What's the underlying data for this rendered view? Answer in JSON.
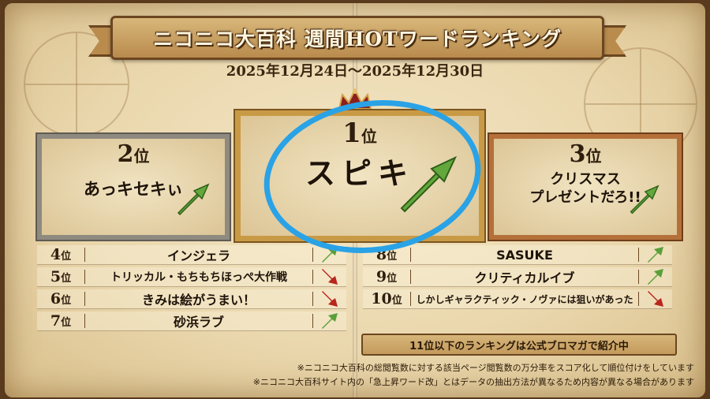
{
  "title": "ニコニコ大百科 週間HOTワードランキング",
  "date_range": "2025年12月24日〜2025年12月30日",
  "rank_suffix": "位",
  "top3": [
    {
      "rank": "1",
      "word": "スピキ",
      "trend": "up"
    },
    {
      "rank": "2",
      "word": "あっキセキぃ",
      "trend": "up"
    },
    {
      "rank": "3",
      "word": "クリスマス\nプレゼントだろ!!",
      "trend": "up"
    }
  ],
  "left_list": [
    {
      "rank": "4",
      "word": "インジェラ",
      "trend": "up"
    },
    {
      "rank": "5",
      "word": "トリッカル・もちもちほっぺ大作戦",
      "trend": "down"
    },
    {
      "rank": "6",
      "word": "きみは絵がうまい！",
      "trend": "down"
    },
    {
      "rank": "7",
      "word": "砂浜ラブ",
      "trend": "up"
    }
  ],
  "right_list": [
    {
      "rank": "8",
      "word": "SASUKE",
      "trend": "up"
    },
    {
      "rank": "9",
      "word": "クリティカルイブ",
      "trend": "up"
    },
    {
      "rank": "10",
      "word": "しかしギャラクティック・ノヴァには狙いがあった",
      "trend": "down"
    }
  ],
  "more_note": "11位以下のランキングは公式ブロマガで紹介中",
  "footnotes": [
    "※ニコニコ大百科の総閲覧数に対する該当ページ閲覧数の万分率をスコア化して順位付けをしています",
    "※ニコニコ大百科サイト内の「急上昇ワード改」とはデータの抽出方法が異なるため内容が異なる場合があります"
  ],
  "colors": {
    "up_arrow": "#5aa03a",
    "down_arrow": "#b8261c",
    "annotation": "#2aa2e6"
  }
}
